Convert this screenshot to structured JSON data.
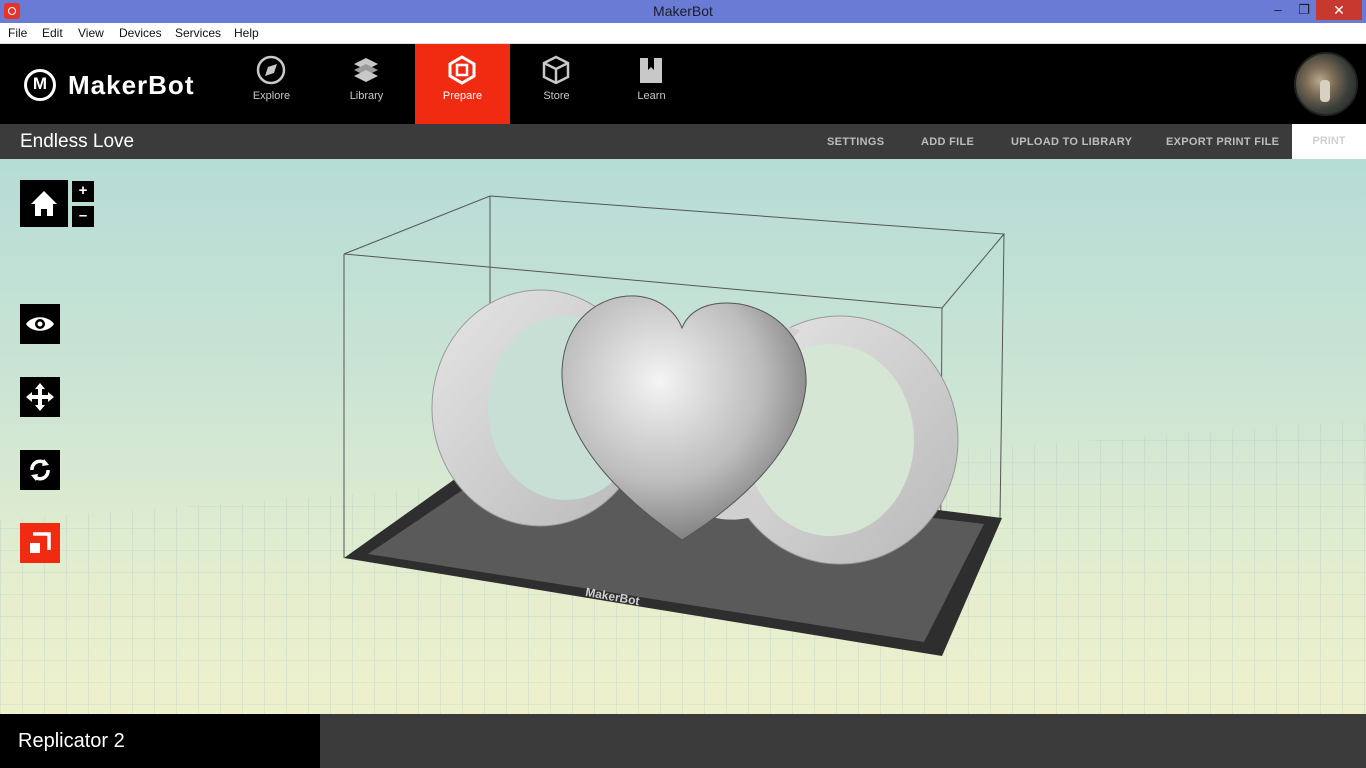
{
  "window": {
    "title": "MakerBot",
    "minimize": "–",
    "restore": "❐",
    "close": "✕"
  },
  "menu": [
    "File",
    "Edit",
    "View",
    "Devices",
    "Services",
    "Help"
  ],
  "brand": {
    "name": "MakerBot"
  },
  "nav": {
    "tabs": [
      {
        "label": "Explore",
        "icon": "compass-icon",
        "active": false
      },
      {
        "label": "Library",
        "icon": "library-icon",
        "active": false
      },
      {
        "label": "Prepare",
        "icon": "prepare-icon",
        "active": true
      },
      {
        "label": "Store",
        "icon": "cube-icon",
        "active": false
      },
      {
        "label": "Learn",
        "icon": "book-icon",
        "active": false
      }
    ]
  },
  "project": {
    "title": "Endless Love",
    "actions": [
      "SETTINGS",
      "ADD FILE",
      "UPLOAD TO LIBRARY",
      "EXPORT PRINT FILE"
    ],
    "print_label": "PRINT"
  },
  "viewport": {
    "build_plate_label": "MakerBot",
    "zoom_in": "+",
    "zoom_out": "–",
    "tools": [
      "eye-icon",
      "move-icon",
      "rotate-icon",
      "scale-icon"
    ]
  },
  "bottom": {
    "printer": "Replicator 2"
  },
  "colors": {
    "accent": "#f12a12",
    "bar": "#3b3b3b",
    "titlebar": "#6a7bd6"
  }
}
